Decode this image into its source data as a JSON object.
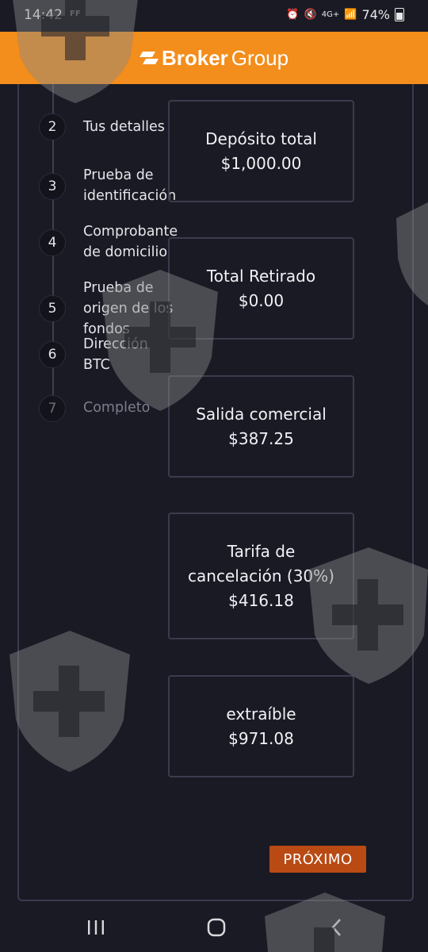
{
  "status_bar": {
    "time": "14:42",
    "carrier_badge": "FF",
    "network": "4G+",
    "battery": "74%"
  },
  "header": {
    "logo_bold": "Broker",
    "logo_light": "Group",
    "accent": "#f38d1b"
  },
  "steps": [
    {
      "number": "2",
      "label": "Tus detalles"
    },
    {
      "number": "3",
      "label": "Prueba de identificación"
    },
    {
      "number": "4",
      "label": "Comprobante de domicilio"
    },
    {
      "number": "5",
      "label": "Prueba de origen de los fondos"
    },
    {
      "number": "6",
      "label": "Dirección BTC"
    },
    {
      "number": "7",
      "label": "Completo"
    }
  ],
  "cards": [
    {
      "title": "Depósito total",
      "value": "$1,000.00"
    },
    {
      "title": "Total Retirado",
      "value": "$0.00"
    },
    {
      "title": "Salida comercial",
      "value": "$387.25"
    },
    {
      "title_line1": "Tarifa de",
      "title_line2": "cancelación (30%)",
      "value": "$416.18"
    },
    {
      "title": "extraíble",
      "value": "$971.08"
    }
  ],
  "next_button": "PRÓXIMO",
  "nav": {
    "recents_icon": "recents-icon",
    "home_icon": "home-icon",
    "back_icon": "back-icon"
  }
}
